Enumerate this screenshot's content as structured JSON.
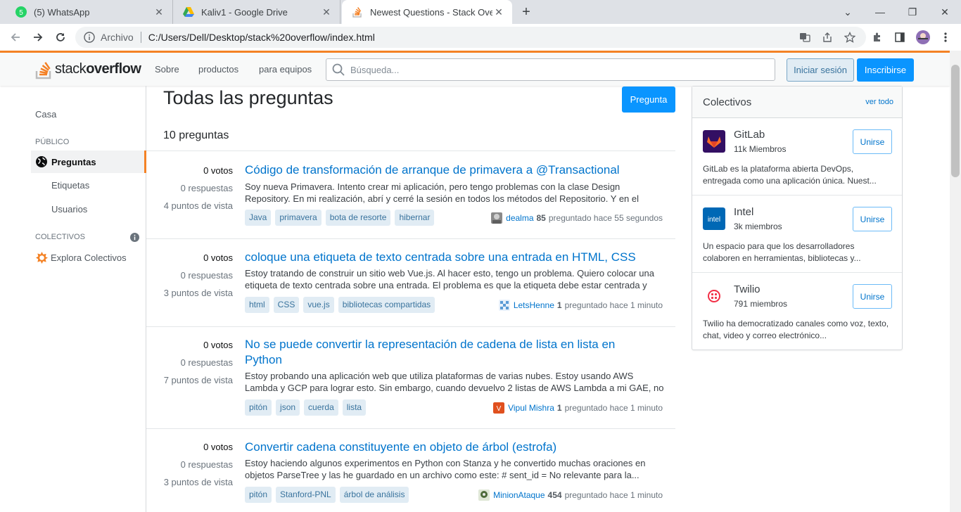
{
  "browser": {
    "tabs": [
      {
        "title": "(5) WhatsApp",
        "icon": "whatsapp-icon"
      },
      {
        "title": "Kaliv1 - Google Drive",
        "icon": "google-drive-icon"
      },
      {
        "title": "Newest Questions - Stack Overflow",
        "icon": "stackoverflow-icon"
      }
    ],
    "address": {
      "security_label": "Archivo",
      "url": "C:/Users/Dell/Desktop/stack%20overflow/index.html"
    }
  },
  "header": {
    "logo_light": "stack",
    "logo_bold": "overflow",
    "nav": [
      "Sobre",
      "productos",
      "para equipos"
    ],
    "search_placeholder": "Búsqueda...",
    "login_label": "Iniciar sesión",
    "signup_label": "Inscribirse"
  },
  "sidebar": {
    "home": "Casa",
    "public_section": "PÚBLICO",
    "questions": "Preguntas",
    "tags": "Etiquetas",
    "users": "Usuarios",
    "collectives_section": "COLECTIVOS",
    "explore_collectives": "Explora Colectivos"
  },
  "main": {
    "title": "Todas las preguntas",
    "ask_label": "Pregunta",
    "count": "10 preguntas",
    "questions": [
      {
        "votes": "0",
        "votes_label": "votos",
        "answers": "0 respuestas",
        "views": "4 puntos de vista",
        "title": "Código de transformación de arranque de primavera a @Transactional",
        "excerpt": "Soy nueva Primavera. Intento crear mi aplicación, pero tengo problemas con la clase Design Repository. En mi realización, abrí y cerré la sesión en todos los métodos del Repositorio. Y en el método de...",
        "tags": [
          "Java",
          "primavera",
          "bota de resorte",
          "hibernar"
        ],
        "user": "dealma",
        "rep": "85",
        "time": "preguntado hace 55 segundos"
      },
      {
        "votes": "0",
        "votes_label": "votos",
        "answers": "0 respuestas",
        "views": "3 puntos de vista",
        "title": "coloque una etiqueta de texto centrada sobre una entrada en HTML, CSS",
        "excerpt": "Estoy tratando de construir un sitio web Vue.js. Al hacer esto, tengo un problema. Quiero colocar una etiqueta de texto centrada sobre una entrada. El problema es que la etiqueta debe estar centrada y la...",
        "tags": [
          "html",
          "CSS",
          "vue.js",
          "bibliotecas compartidas"
        ],
        "user": "LetsHenne",
        "rep": "1",
        "time": "preguntado hace 1 minuto"
      },
      {
        "votes": "0",
        "votes_label": "votos",
        "answers": "0 respuestas",
        "views": "7 puntos de vista",
        "title": "No se puede convertir la representación de cadena de lista en lista en Python",
        "excerpt": "Estoy probando una aplicación web que utiliza plataformas de varias nubes. Estoy usando AWS Lambda y GCP para lograr esto. Sin embargo, cuando devuelvo 2 listas de AWS Lambda a mi GAE, no puedo...",
        "tags": [
          "pitón",
          "json",
          "cuerda",
          "lista"
        ],
        "user": "Vipul Mishra",
        "rep": "1",
        "time": "preguntado hace 1 minuto"
      },
      {
        "votes": "0",
        "votes_label": "votos",
        "answers": "0 respuestas",
        "views": "3 puntos de vista",
        "title": "Convertir cadena constituyente en objeto de árbol (estrofa)",
        "excerpt": "Estoy haciendo algunos experimentos en Python con Stanza y he convertido muchas oraciones en objetos ParseTree y las he guardado en un archivo como este: # sent_id = No relevante para la...",
        "tags": [
          "pitón",
          "Stanford-PNL",
          "árbol de análisis"
        ],
        "user": "MinionAtaque",
        "rep": "454",
        "time": "preguntado hace 1 minuto"
      }
    ]
  },
  "collectives": {
    "title": "Colectivos",
    "see_all": "ver todo",
    "join_label": "Unirse",
    "items": [
      {
        "name": "GitLab",
        "members": "11k Miembros",
        "desc": "GitLab es la plataforma abierta DevOps, entregada como una aplicación única. Nuest..."
      },
      {
        "name": "Intel",
        "members": "3k miembros",
        "desc": "Un espacio para que los desarrolladores colaboren en herramientas, bibliotecas y..."
      },
      {
        "name": "Twilio",
        "members": "791 miembros",
        "desc": "Twilio ha democratizado canales como voz, texto, chat, video y correo electrónico..."
      }
    ]
  },
  "colors": {
    "accent": "#f48225",
    "link": "#0074cc",
    "primary_button": "#0a95ff",
    "tag_bg": "#e1ecf4"
  }
}
